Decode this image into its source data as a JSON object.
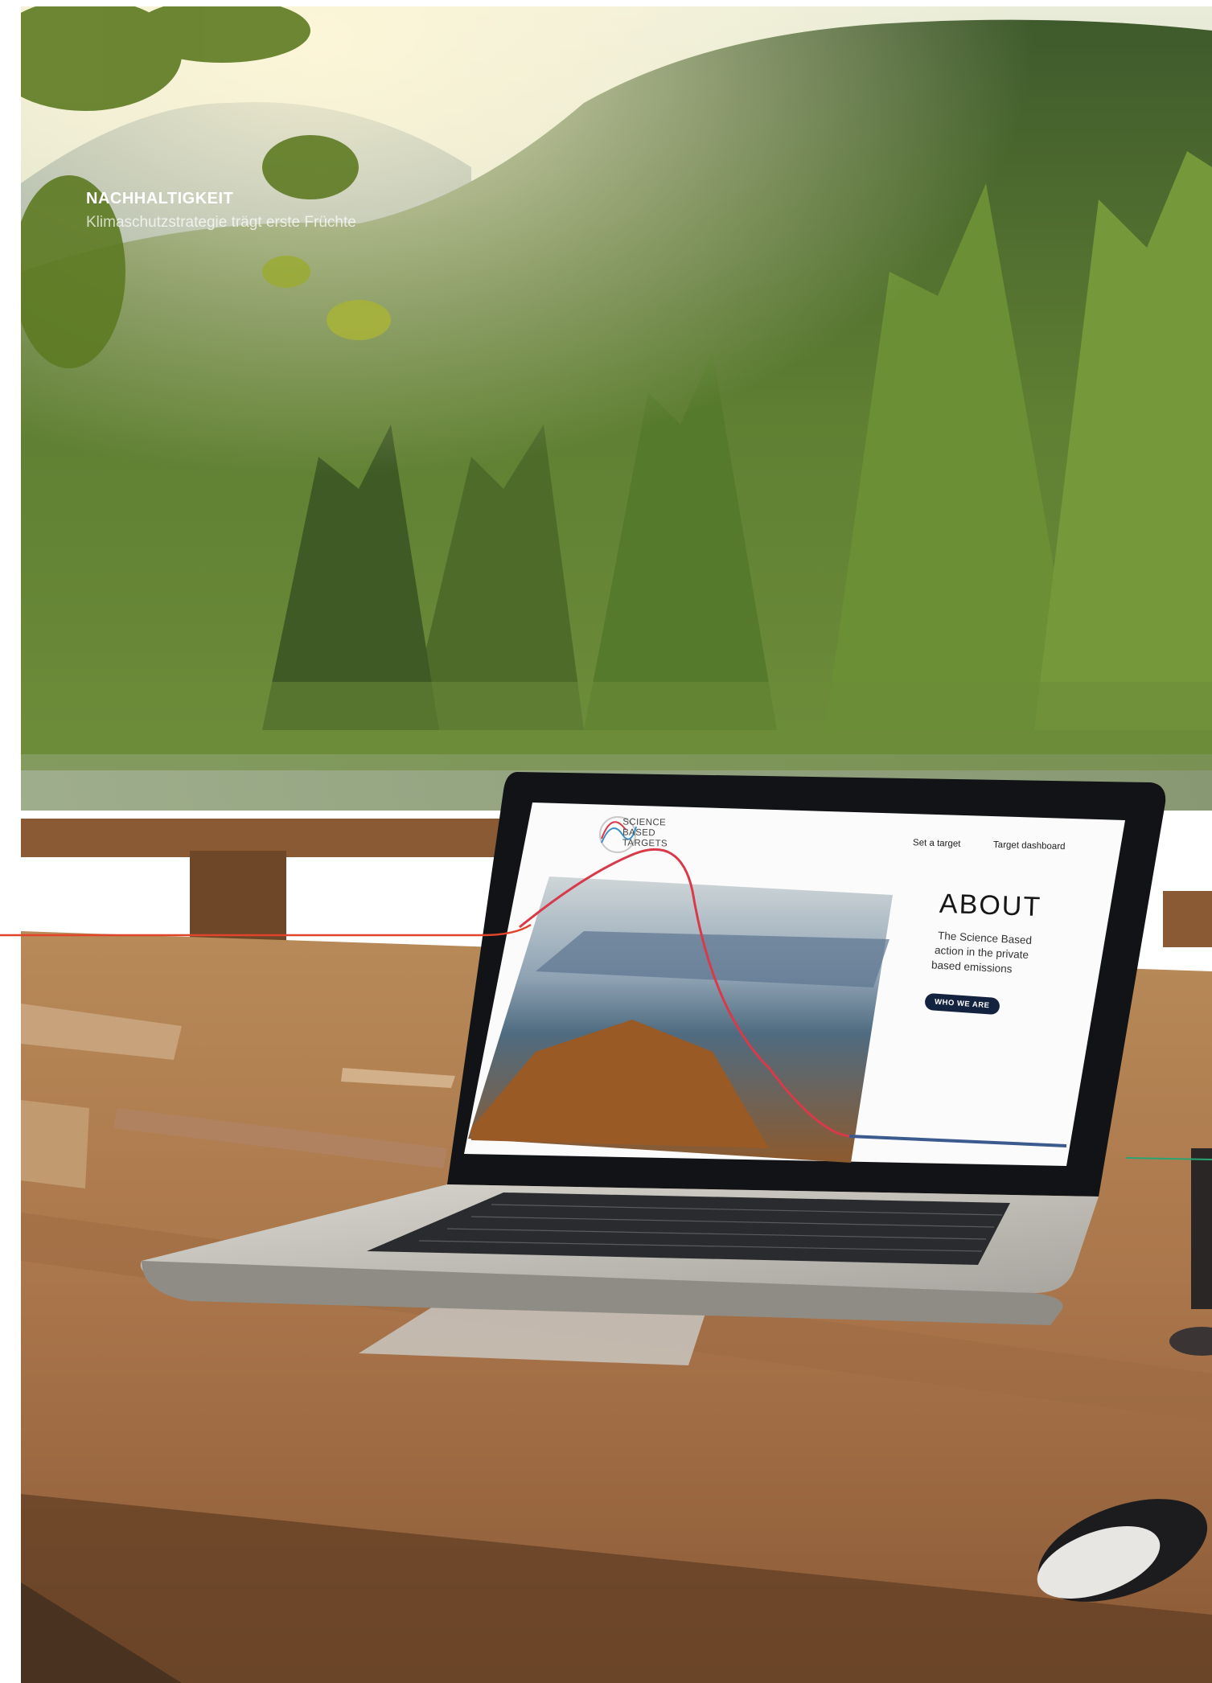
{
  "caption": {
    "category": "NACHHALTIGKEIT",
    "subtitle": "Klimaschutzstrategie trägt erste Früchte"
  },
  "laptop_screen": {
    "brand_lines": [
      "SCIENCE",
      "BASED",
      "TARGETS"
    ],
    "nav": [
      "Set a target",
      "Target dashboard"
    ],
    "heading": "ABOUT",
    "body_lines": [
      "The Science Based",
      "action in the private",
      "based emissions"
    ],
    "button_label": "WHO WE ARE"
  },
  "colors": {
    "accent_line": "#e0452c",
    "curve_red": "#d83a4a",
    "button_navy": "#13233f"
  }
}
